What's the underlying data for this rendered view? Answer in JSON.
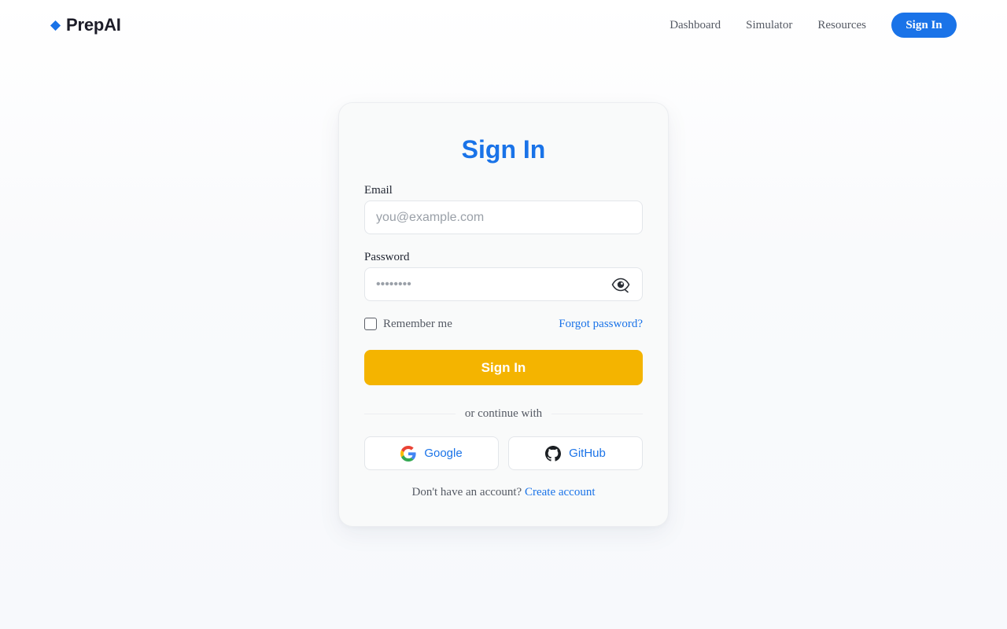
{
  "brand": {
    "name": "PrepAI",
    "icon": "diamond-icon",
    "color": "#1a73e8"
  },
  "nav": {
    "links": [
      "Dashboard",
      "Simulator",
      "Resources"
    ],
    "signin_label": "Sign In"
  },
  "card": {
    "title": "Sign In",
    "email": {
      "label": "Email",
      "placeholder": "you@example.com",
      "value": ""
    },
    "password": {
      "label": "Password",
      "placeholder": "••••••••",
      "value": "",
      "toggle_icon": "eye-icon"
    },
    "remember_label": "Remember me",
    "remember_checked": false,
    "forgot_label": "Forgot password?",
    "submit_label": "Sign In",
    "divider_text": "or continue with",
    "social": {
      "google_label": "Google",
      "github_label": "GitHub"
    },
    "footer": {
      "prompt": "Don't have an account?",
      "link_label": "Create account"
    }
  },
  "colors": {
    "primary": "#1a73e8",
    "accent": "#f4b400"
  }
}
